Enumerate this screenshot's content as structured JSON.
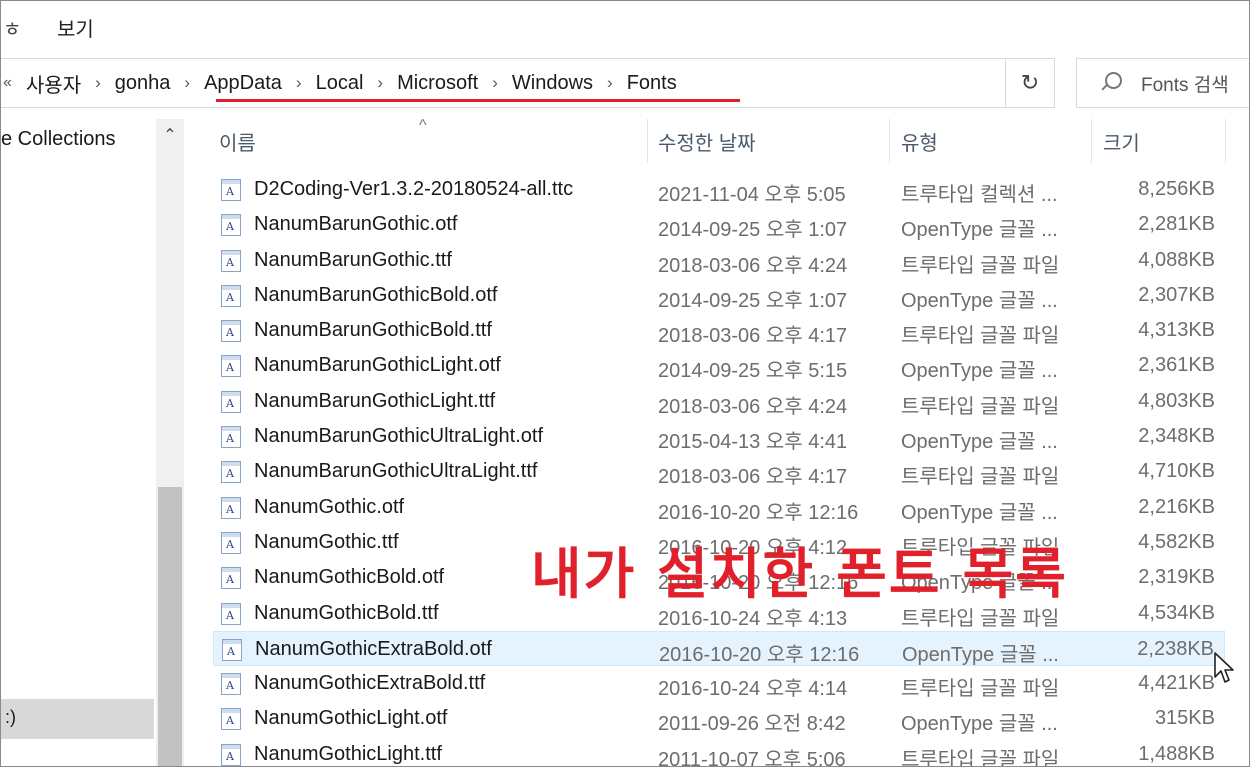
{
  "ribbon": {
    "partial_left": "ㅎ",
    "view_tab": "보기"
  },
  "address": {
    "more": "«",
    "crumbs": [
      "사용자",
      "gonha",
      "AppData",
      "Local",
      "Microsoft",
      "Windows",
      "Fonts"
    ],
    "separator": "›",
    "dropdown": "⌄",
    "refresh": "↻"
  },
  "search": {
    "placeholder": "Fonts 검색"
  },
  "nav": {
    "collections": "e Collections",
    "drive": ":)",
    "scroll_up": "⌃"
  },
  "columns": {
    "sort_caret": "^",
    "name": "이름",
    "date": "수정한 날짜",
    "type": "유형",
    "size": "크기"
  },
  "file_icon_glyph": "A",
  "files": [
    {
      "name": "D2Coding-Ver1.3.2-20180524-all.ttc",
      "date": "2021-11-04 오후 5:05",
      "type": "트루타입 컬렉션 ...",
      "size": "8,256KB"
    },
    {
      "name": "NanumBarunGothic.otf",
      "date": "2014-09-25 오후 1:07",
      "type": "OpenType 글꼴 ...",
      "size": "2,281KB"
    },
    {
      "name": "NanumBarunGothic.ttf",
      "date": "2018-03-06 오후 4:24",
      "type": "트루타입 글꼴 파일",
      "size": "4,088KB"
    },
    {
      "name": "NanumBarunGothicBold.otf",
      "date": "2014-09-25 오후 1:07",
      "type": "OpenType 글꼴 ...",
      "size": "2,307KB"
    },
    {
      "name": "NanumBarunGothicBold.ttf",
      "date": "2018-03-06 오후 4:17",
      "type": "트루타입 글꼴 파일",
      "size": "4,313KB"
    },
    {
      "name": "NanumBarunGothicLight.otf",
      "date": "2014-09-25 오후 5:15",
      "type": "OpenType 글꼴 ...",
      "size": "2,361KB"
    },
    {
      "name": "NanumBarunGothicLight.ttf",
      "date": "2018-03-06 오후 4:24",
      "type": "트루타입 글꼴 파일",
      "size": "4,803KB"
    },
    {
      "name": "NanumBarunGothicUltraLight.otf",
      "date": "2015-04-13 오후 4:41",
      "type": "OpenType 글꼴 ...",
      "size": "2,348KB"
    },
    {
      "name": "NanumBarunGothicUltraLight.ttf",
      "date": "2018-03-06 오후 4:17",
      "type": "트루타입 글꼴 파일",
      "size": "4,710KB"
    },
    {
      "name": "NanumGothic.otf",
      "date": "2016-10-20 오후 12:16",
      "type": "OpenType 글꼴 ...",
      "size": "2,216KB"
    },
    {
      "name": "NanumGothic.ttf",
      "date": "2016-10-20 오후 4:12",
      "type": "트루타입 글꼴 파일",
      "size": "4,582KB"
    },
    {
      "name": "NanumGothicBold.otf",
      "date": "2016-10-20 오후 12:16",
      "type": "OpenType 글꼴 ...",
      "size": "2,319KB"
    },
    {
      "name": "NanumGothicBold.ttf",
      "date": "2016-10-24 오후 4:13",
      "type": "트루타입 글꼴 파일",
      "size": "4,534KB"
    },
    {
      "name": "NanumGothicExtraBold.otf",
      "date": "2016-10-20 오후 12:16",
      "type": "OpenType 글꼴 ...",
      "size": "2,238KB",
      "highlighted": true
    },
    {
      "name": "NanumGothicExtraBold.ttf",
      "date": "2016-10-24 오후 4:14",
      "type": "트루타입 글꼴 파일",
      "size": "4,421KB"
    },
    {
      "name": "NanumGothicLight.otf",
      "date": "2011-09-26 오전 8:42",
      "type": "OpenType 글꼴 ...",
      "size": "315KB"
    },
    {
      "name": "NanumGothicLight.ttf",
      "date": "2011-10-07 오후 5:06",
      "type": "트루타입 글꼴 파일",
      "size": "1,488KB"
    }
  ],
  "annotation": {
    "text": "내가 설치한 폰트 목록",
    "color": "#e0202a"
  },
  "colors": {
    "highlight_row": "#e5f3ff",
    "annotation": "#e0202a"
  }
}
